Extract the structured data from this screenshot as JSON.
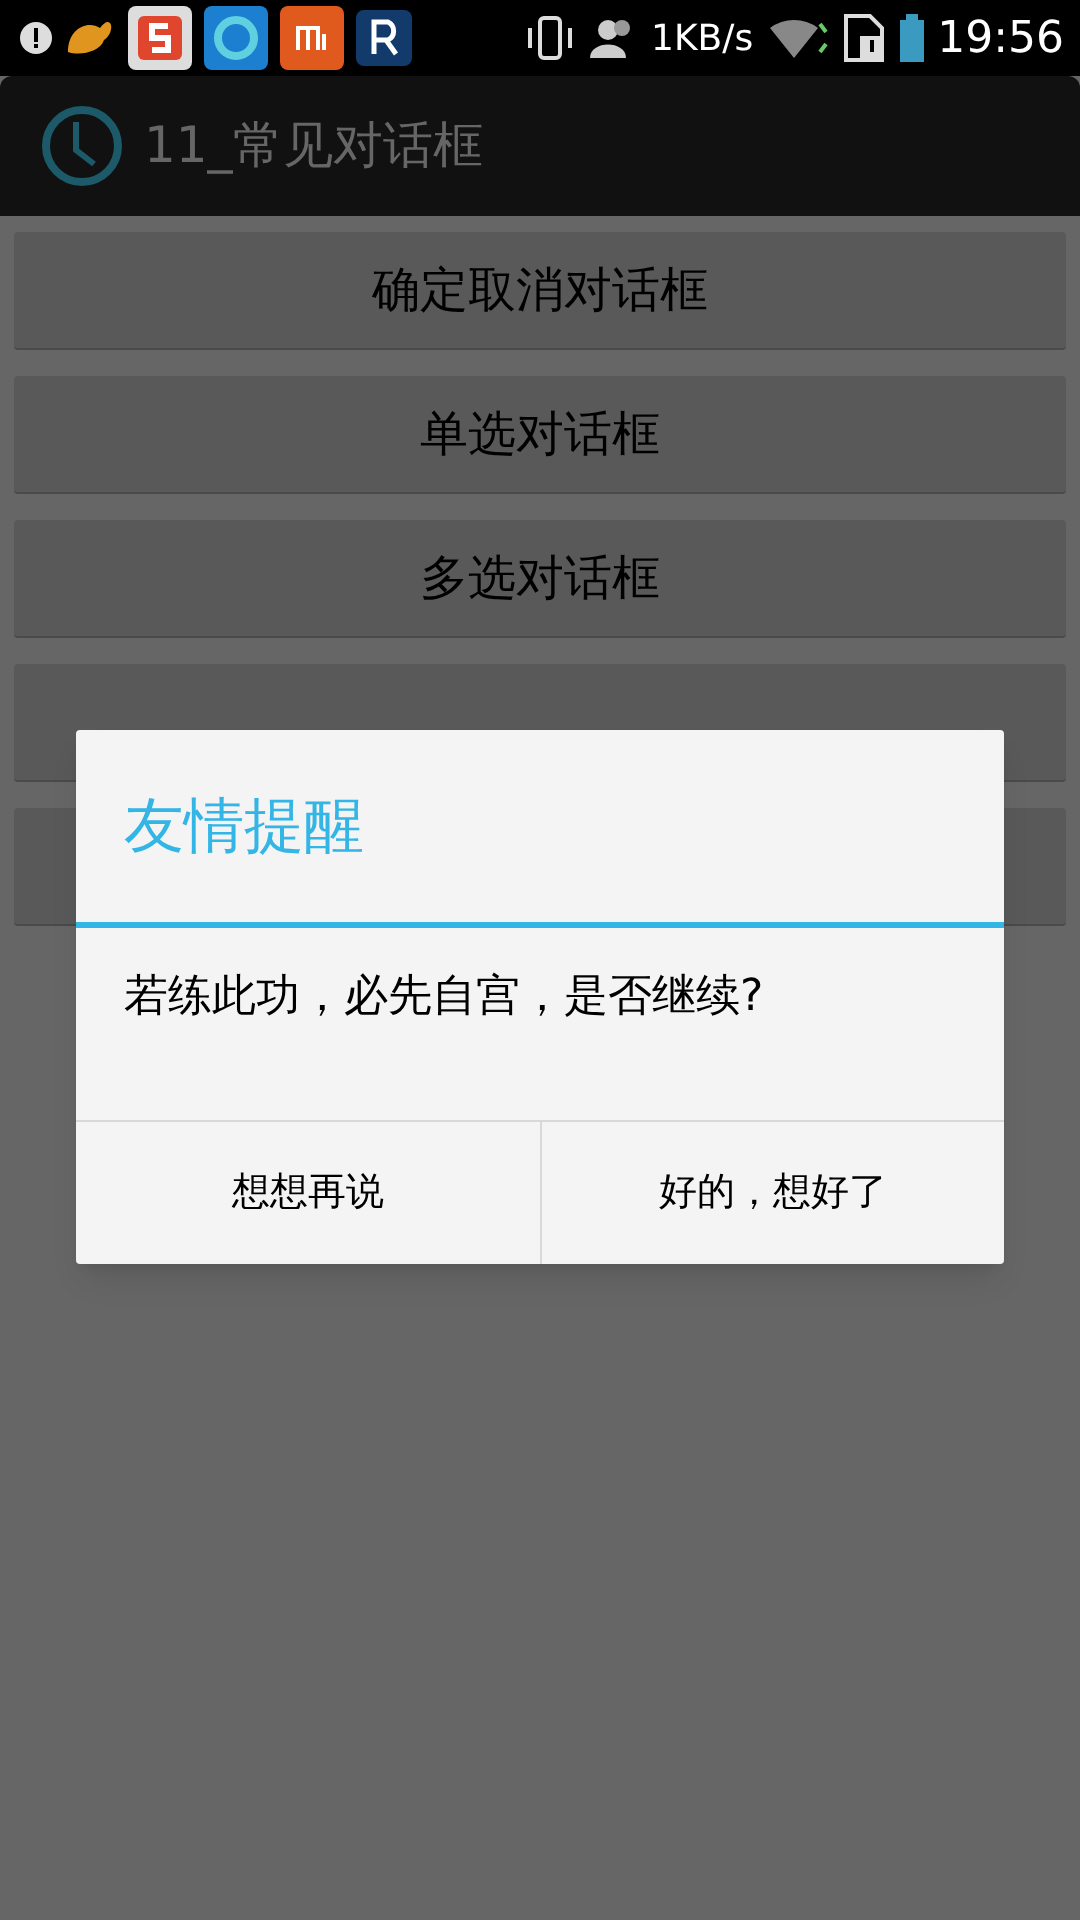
{
  "status_bar": {
    "net_speed": "1KB/s",
    "time": "19:56"
  },
  "action_bar": {
    "title": "11_常见对话框"
  },
  "buttons": [
    {
      "label": "确定取消对话框"
    },
    {
      "label": "单选对话框"
    },
    {
      "label": "多选对话框"
    }
  ],
  "dialog": {
    "title": "友情提醒",
    "message": "若练此功，必先自宫，是否继续?",
    "buttons": [
      "想想再说",
      "好的，想好了"
    ]
  }
}
